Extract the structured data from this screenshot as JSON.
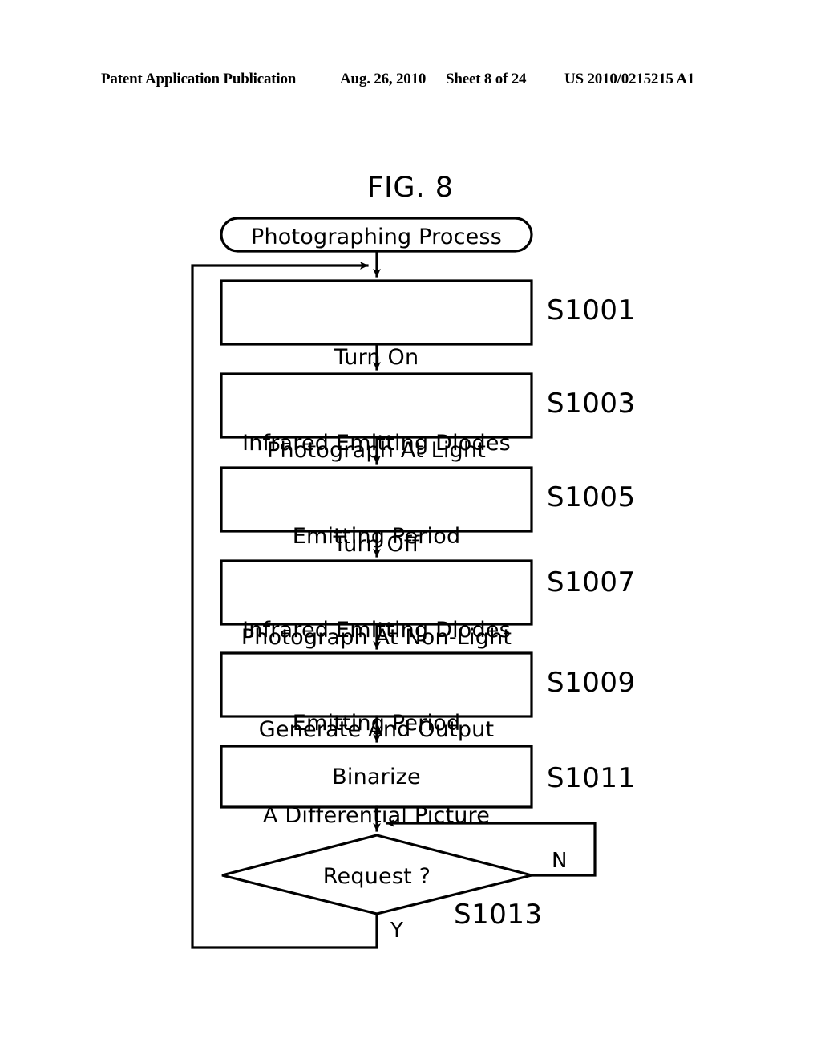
{
  "header": {
    "publication": "Patent Application Publication",
    "date": "Aug. 26, 2010",
    "sheet": "Sheet 8 of 24",
    "patent_number": "US 2010/0215215 A1"
  },
  "figure": {
    "title": "FIG. 8",
    "start_terminal": {
      "label": "Photographing Process"
    },
    "steps": [
      {
        "id": "S1001",
        "line1": "Turn On",
        "line2": "Infrared Emitting Diodes"
      },
      {
        "id": "S1003",
        "line1": "Photograph At Light",
        "line2": "Emitting Period"
      },
      {
        "id": "S1005",
        "line1": "Turn Off",
        "line2": "Infrared Emitting Diodes"
      },
      {
        "id": "S1007",
        "line1": "Photograph At Non-Light",
        "line2": "Emitting Period"
      },
      {
        "id": "S1009",
        "line1": "Generate And Output",
        "line2": "A Differential Picture"
      },
      {
        "id": "S1011",
        "line1": "Binarize",
        "line2": ""
      }
    ],
    "decision": {
      "id": "S1013",
      "label": "Request ?",
      "yes_label": "Y",
      "no_label": "N"
    },
    "colors": {
      "stroke": "#000000",
      "background": "#ffffff"
    }
  }
}
